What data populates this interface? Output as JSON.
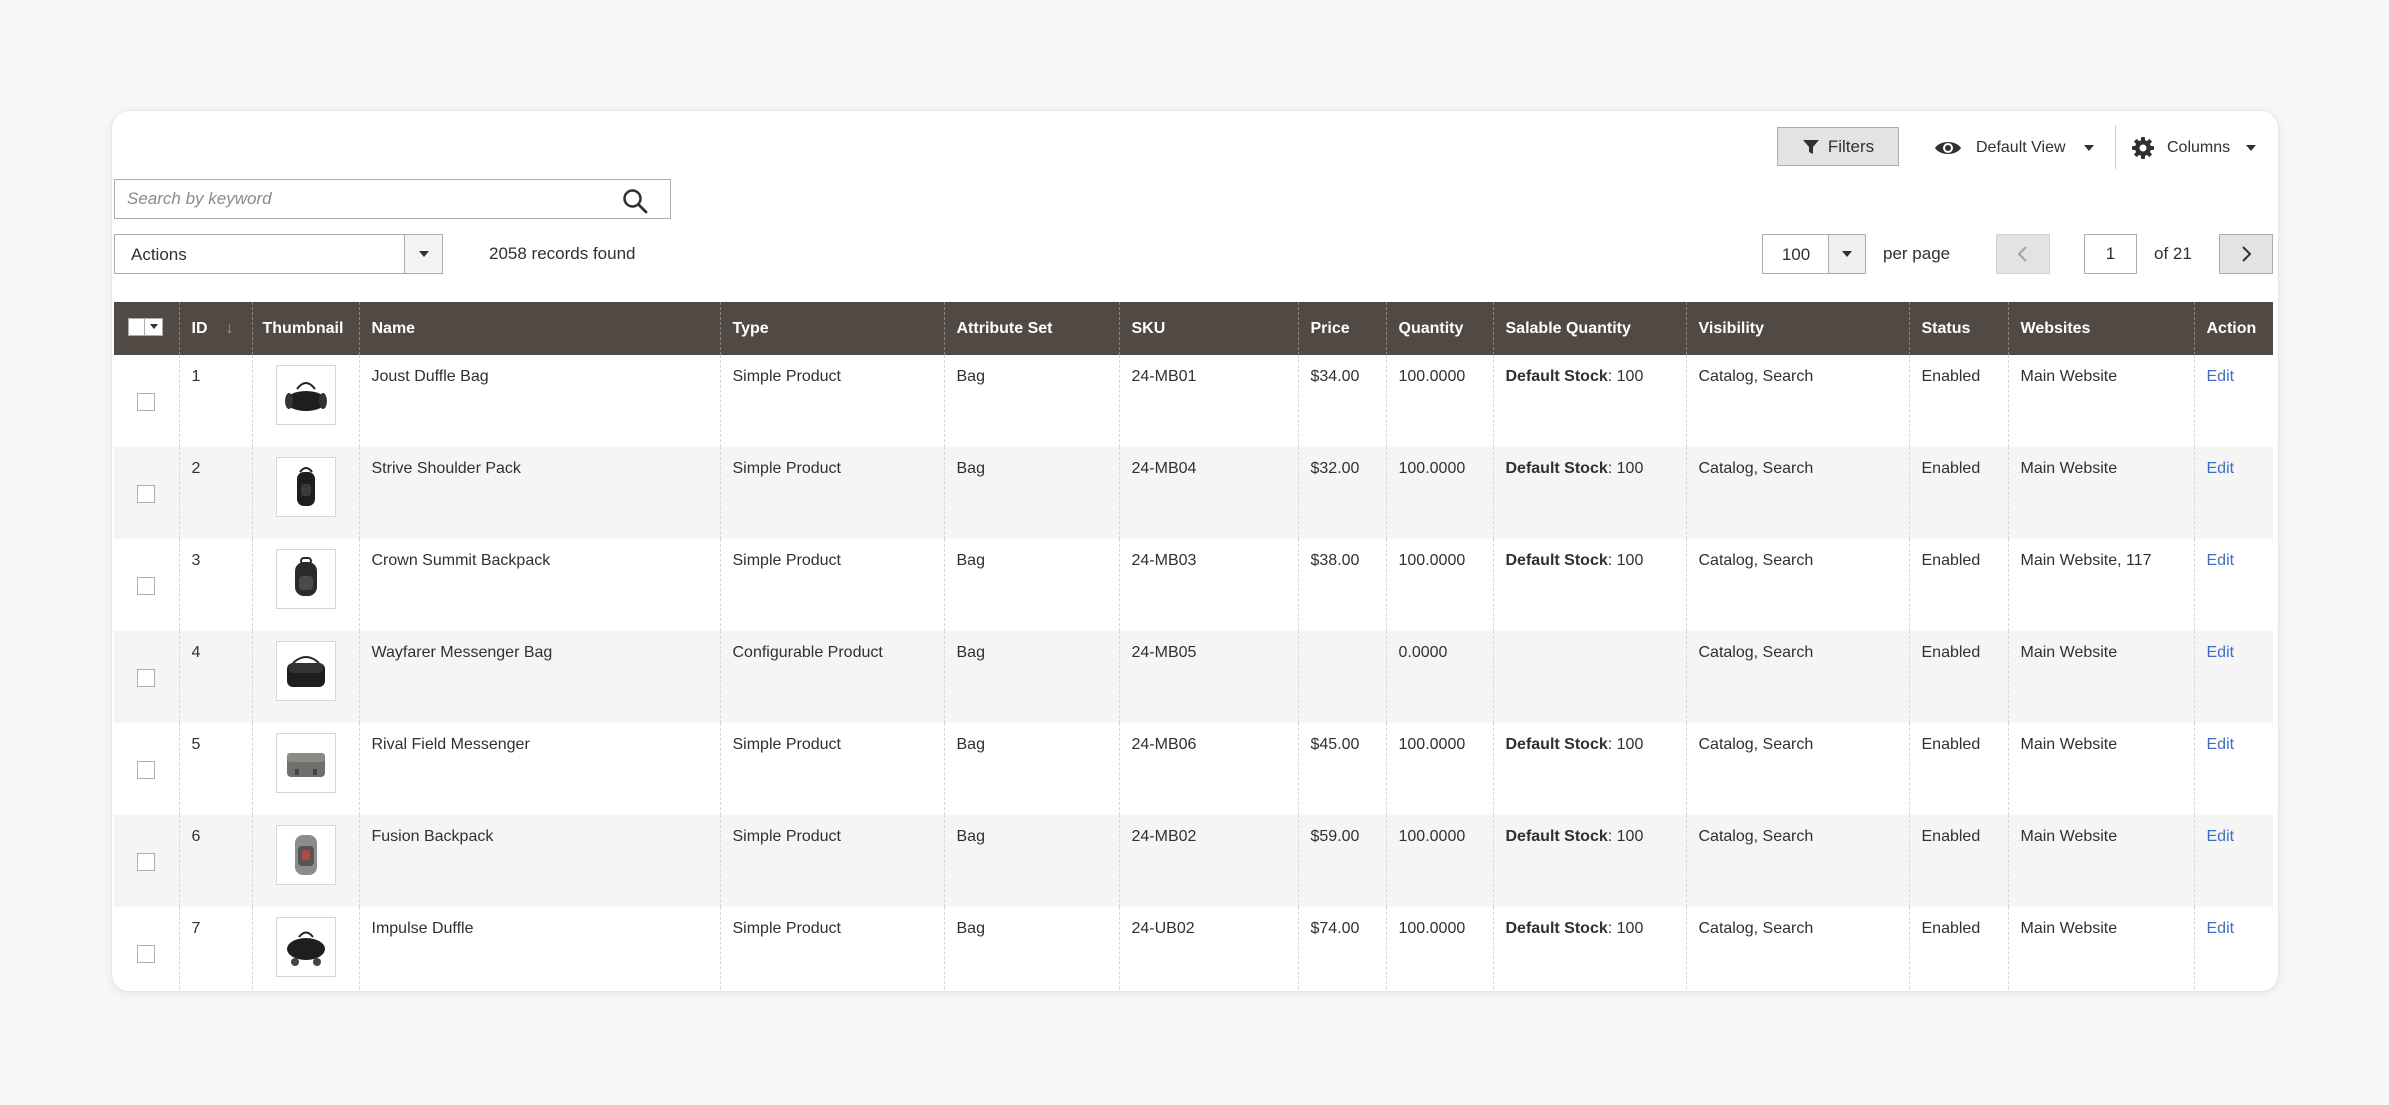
{
  "toolbar": {
    "filters_label": "Filters",
    "view_label": "Default View",
    "columns_label": "Columns"
  },
  "search": {
    "placeholder": "Search by keyword",
    "value": ""
  },
  "actions": {
    "label": "Actions"
  },
  "records_found": "2058 records found",
  "pagination": {
    "per_page_value": "100",
    "per_page_label": "per page",
    "current_page": "1",
    "of_pages": "of 21"
  },
  "columns": {
    "id": "ID",
    "thumbnail": "Thumbnail",
    "name": "Name",
    "type": "Type",
    "attribute_set": "Attribute Set",
    "sku": "SKU",
    "price": "Price",
    "quantity": "Quantity",
    "salable_quantity": "Salable Quantity",
    "visibility": "Visibility",
    "status": "Status",
    "websites": "Websites",
    "action": "Action"
  },
  "rows": [
    {
      "id": "1",
      "thumb": "duffle-bag-icon",
      "name": "Joust Duffle Bag",
      "type": "Simple Product",
      "attribute_set": "Bag",
      "sku": "24-MB01",
      "price": "$34.00",
      "quantity": "100.0000",
      "salable_label": "Default Stock",
      "salable_value": ": 100",
      "visibility": "Catalog, Search",
      "status": "Enabled",
      "websites": "Main Website",
      "action": "Edit"
    },
    {
      "id": "2",
      "thumb": "shoulder-pack-icon",
      "name": "Strive Shoulder Pack",
      "type": "Simple Product",
      "attribute_set": "Bag",
      "sku": "24-MB04",
      "price": "$32.00",
      "quantity": "100.0000",
      "salable_label": "Default Stock",
      "salable_value": ": 100",
      "visibility": "Catalog, Search",
      "status": "Enabled",
      "websites": "Main Website",
      "action": "Edit"
    },
    {
      "id": "3",
      "thumb": "backpack-icon",
      "name": "Crown Summit Backpack",
      "type": "Simple Product",
      "attribute_set": "Bag",
      "sku": "24-MB03",
      "price": "$38.00",
      "quantity": "100.0000",
      "salable_label": "Default Stock",
      "salable_value": ": 100",
      "visibility": "Catalog, Search",
      "status": "Enabled",
      "websites": "Main Website, 117",
      "action": "Edit"
    },
    {
      "id": "4",
      "thumb": "messenger-bag-icon",
      "name": "Wayfarer Messenger Bag",
      "type": "Configurable Product",
      "attribute_set": "Bag",
      "sku": "24-MB05",
      "price": "",
      "quantity": "0.0000",
      "salable_label": "",
      "salable_value": "",
      "visibility": "Catalog, Search",
      "status": "Enabled",
      "websites": "Main Website",
      "action": "Edit"
    },
    {
      "id": "5",
      "thumb": "field-messenger-icon",
      "name": "Rival Field Messenger",
      "type": "Simple Product",
      "attribute_set": "Bag",
      "sku": "24-MB06",
      "price": "$45.00",
      "quantity": "100.0000",
      "salable_label": "Default Stock",
      "salable_value": ": 100",
      "visibility": "Catalog, Search",
      "status": "Enabled",
      "websites": "Main Website",
      "action": "Edit"
    },
    {
      "id": "6",
      "thumb": "fusion-backpack-icon",
      "name": "Fusion Backpack",
      "type": "Simple Product",
      "attribute_set": "Bag",
      "sku": "24-MB02",
      "price": "$59.00",
      "quantity": "100.0000",
      "salable_label": "Default Stock",
      "salable_value": ": 100",
      "visibility": "Catalog, Search",
      "status": "Enabled",
      "websites": "Main Website",
      "action": "Edit"
    },
    {
      "id": "7",
      "thumb": "rolling-duffle-icon",
      "name": "Impulse Duffle",
      "type": "Simple Product",
      "attribute_set": "Bag",
      "sku": "24-UB02",
      "price": "$74.00",
      "quantity": "100.0000",
      "salable_label": "Default Stock",
      "salable_value": ": 100",
      "visibility": "Catalog, Search",
      "status": "Enabled",
      "websites": "Main Website",
      "action": "Edit"
    }
  ],
  "colors": {
    "header_bg": "#514943",
    "link": "#3e6ec4",
    "sort_arrow": "#e38561",
    "stripe": "#f5f5f5"
  },
  "icons": {
    "filters": "funnel-icon",
    "view": "eye-icon",
    "columns": "gear-icon",
    "search": "search-icon",
    "sort": "sort-down-arrow-icon"
  }
}
